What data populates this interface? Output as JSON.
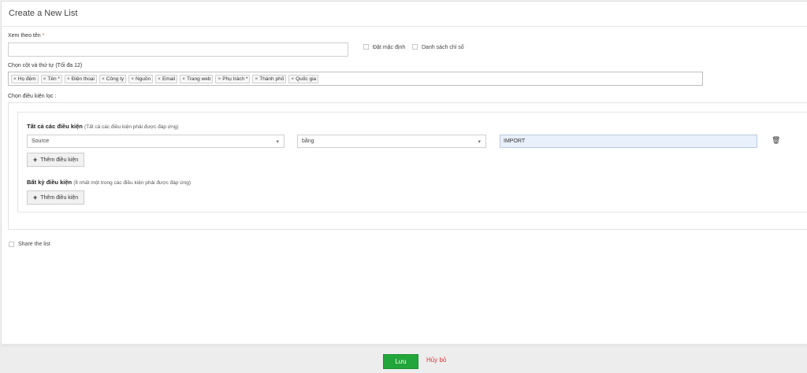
{
  "header": {
    "title": "Create a New List"
  },
  "name_field": {
    "label": "Xem theo tên",
    "required_mark": "*",
    "value": "",
    "placeholder": ""
  },
  "options": {
    "default_label": "Đặt mặc định",
    "readonly_label": "Danh sách chỉ số"
  },
  "columns": {
    "label": "Chọn cột và thứ tự (Tối đa 12)",
    "tags": [
      "Họ đệm",
      "Tên *",
      "Điện thoại",
      "Công ty",
      "Nguồn",
      "Email",
      "Trang web",
      "Phụ trách *",
      "Thành phố",
      "Quốc gia"
    ]
  },
  "filter": {
    "label": "Chọn điều kiện lọc :",
    "all": {
      "title": "Tất cả các điều kiện",
      "note": "(Tất cả các điều kiện phải được đáp ứng)",
      "condition": {
        "field": "Source",
        "operator": "bằng",
        "value": "IMPORT"
      },
      "add_label": "Thêm điều kiện"
    },
    "any": {
      "title": "Bất kỳ điều kiện",
      "note": "(Ít nhất một trong các điều kiện phải được đáp ứng)",
      "add_label": "Thêm điều kiện"
    }
  },
  "share": {
    "label": "Share the list"
  },
  "footer": {
    "save_label": "Lưu",
    "cancel_label": "Hủy bỏ",
    "save_color": "#22a53a",
    "cancel_color": "#e03131"
  }
}
